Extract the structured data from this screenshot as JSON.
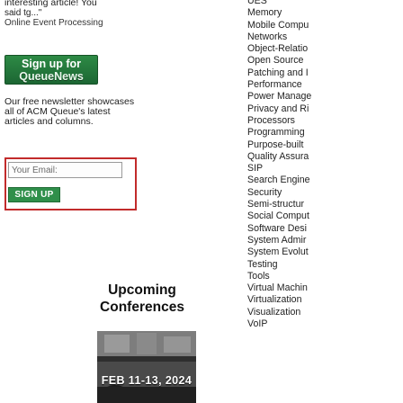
{
  "snippet": {
    "headline": "interesting article! You",
    "quote": "said tg...\"",
    "source": "Online Event Processing"
  },
  "signup_banner": {
    "line1": "Sign up for",
    "line2": "QueueNews"
  },
  "newsletter": {
    "description": "Our free newsletter showcases all of ACM Queue's latest articles and columns.",
    "email_placeholder": "Your Email:",
    "signup_button": "SIGN UP"
  },
  "conferences": {
    "title_line1": "Upcoming",
    "title_line2": "Conferences",
    "promo_date": "FEB 11-13, 2024"
  },
  "topics": [
    "UES",
    "Memory",
    "Mobile Compu",
    "Networks",
    "Object-Relatio",
    "Open Source",
    "Patching and I",
    "Performance",
    "Power Manage",
    "Privacy and Ri",
    "Processors",
    "Programming",
    "Purpose-built",
    "Quality Assura",
    "SIP",
    "Search Engine",
    "Security",
    "Semi-structur",
    "Social Comput",
    "Software Desi",
    "System Admir",
    "System Evolut",
    "Testing",
    "Tools",
    "Virtual Machin",
    "Virtualization",
    "Visualization",
    "VoIP"
  ],
  "colors": {
    "banner_green": "#2d8a45",
    "email_border_red": "#c22b2b",
    "button_green": "#2f8f4a"
  }
}
